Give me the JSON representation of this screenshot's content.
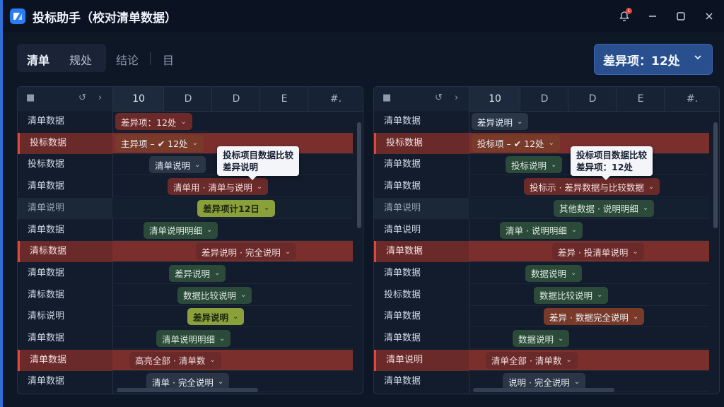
{
  "window": {
    "title": "投标助手（校对清单数据）",
    "notification_badge": "1"
  },
  "toolbar": {
    "tab_active": "清单",
    "tab_2": "规处",
    "tab_3": "结论",
    "tab_4": "目",
    "diff_button_label": "差异项：12处"
  },
  "left_panel": {
    "columns": [
      "10",
      "D",
      "D",
      "E",
      "#."
    ],
    "row_labels": [
      "清单数据",
      "投标数据",
      "投标数据",
      "清单数据",
      "清单说明",
      "清单数据",
      "清标数据",
      "清单数据",
      "清标数据",
      "清标说明",
      "清单数据",
      "清单数据",
      "清单数据"
    ],
    "row_states": [
      "normal",
      "hl",
      "normal",
      "normal",
      "soft",
      "normal",
      "hl",
      "normal",
      "normal",
      "normal",
      "normal",
      "hl",
      "normal"
    ],
    "cells": [
      {
        "text": "差异项：12处",
        "style": "red"
      },
      {
        "text": "主异项 – ✔ 12处",
        "style": "orange"
      },
      {
        "text": "清单说明",
        "style": "gray"
      },
      {
        "text": "清单用 · 清单与说明",
        "style": "red"
      },
      {
        "text": "差异项计12日",
        "style": "yellow"
      },
      {
        "text": "清单说明明细",
        "style": "green"
      },
      {
        "text": "差异说明 · 完全说明",
        "style": "red"
      },
      {
        "text": "差异说明",
        "style": "green"
      },
      {
        "text": "数据比较说明",
        "style": "green"
      },
      {
        "text": "差异说明",
        "style": "yellow"
      },
      {
        "text": "清单说明明细",
        "style": "green"
      },
      {
        "text": "高亮全部  · 清单数",
        "style": "red"
      },
      {
        "text": "清单 · 完全说明",
        "style": "gray"
      }
    ],
    "tooltip_line1": "投标项目数据比较",
    "tooltip_line2": "差异说明"
  },
  "right_panel": {
    "columns": [
      "10",
      "D",
      "D",
      "E",
      "#."
    ],
    "row_labels": [
      "清单数据",
      "投标数据",
      "清单数据",
      "清单数据",
      "清单说明",
      "清单说明",
      "清单数据",
      "清单数据",
      "投标数据",
      "清单数据",
      "清单数据",
      "清单说明",
      "清单数据"
    ],
    "row_states": [
      "normal",
      "hl",
      "normal",
      "normal",
      "soft",
      "normal",
      "hl",
      "normal",
      "normal",
      "normal",
      "normal",
      "hl",
      "normal"
    ],
    "cells": [
      {
        "text": "差异说明",
        "style": "gray"
      },
      {
        "text": "投标项 – ✔ 12处",
        "style": "orange"
      },
      {
        "text": "投标说明",
        "style": "green"
      },
      {
        "text": "投标示 · 差异数据与比较数据",
        "style": "red"
      },
      {
        "text": "其他数据 · 说明明细",
        "style": "green"
      },
      {
        "text": "清单 · 说明明细",
        "style": "green"
      },
      {
        "text": "差异 · 投清单说明",
        "style": "red"
      },
      {
        "text": "数据说明",
        "style": "green"
      },
      {
        "text": "数据比较说明",
        "style": "green"
      },
      {
        "text": "差异 · 数据完全说明",
        "style": "orange"
      },
      {
        "text": "数据说明",
        "style": "green"
      },
      {
        "text": "清单全部 · 清单数",
        "style": "red"
      },
      {
        "text": "说明 · 完全说明",
        "style": "gray"
      }
    ],
    "tooltip_line1": "投标项目数据比较",
    "tooltip_line2": "差异项：12处"
  }
}
